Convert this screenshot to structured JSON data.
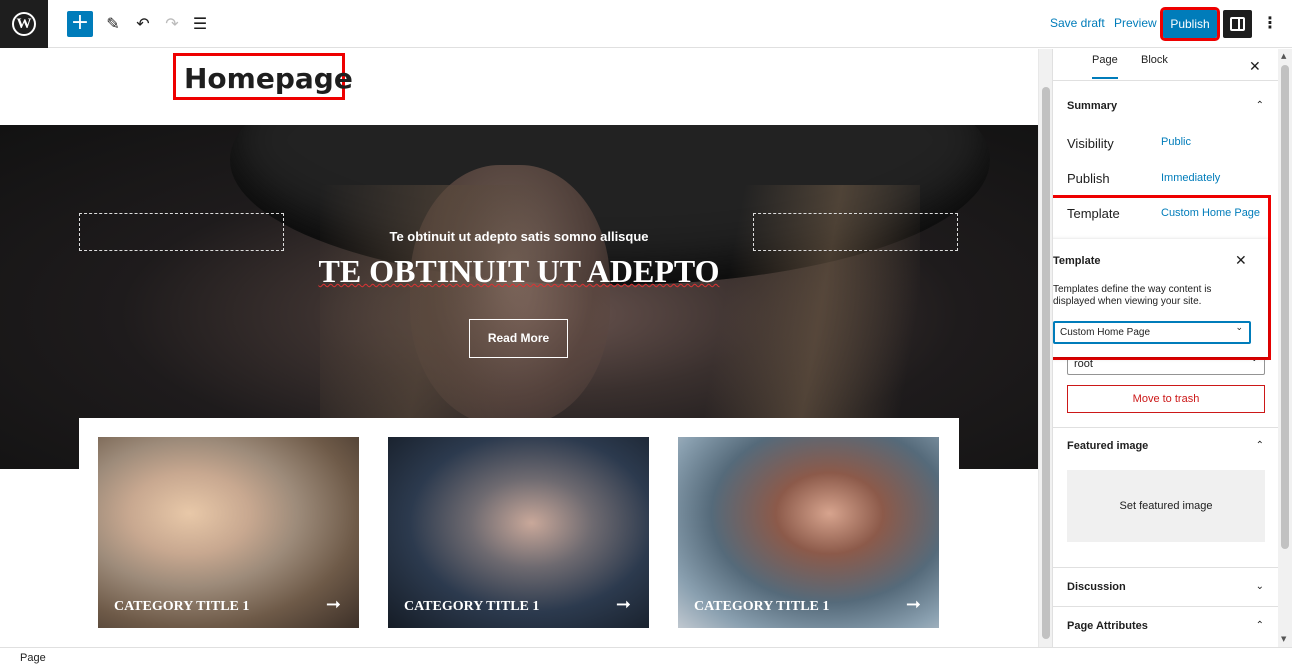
{
  "toolbar": {
    "add_icon": "plus-icon",
    "save_draft": "Save draft",
    "preview": "Preview",
    "publish": "Publish"
  },
  "page": {
    "title": "Homepage"
  },
  "hero": {
    "subtitle": "Te obtinuit ut adepto satis somno allisque",
    "title": "TE OBTINUIT UT ADEPTO",
    "button": "Read More"
  },
  "cards": [
    {
      "label": "CATEGORY TITLE 1"
    },
    {
      "label": "CATEGORY TITLE 1"
    },
    {
      "label": "CATEGORY TITLE 1"
    }
  ],
  "sidebar": {
    "tabs": [
      "Page",
      "Block"
    ],
    "summary": {
      "heading": "Summary",
      "rows": [
        {
          "label": "Visibility",
          "value": "Public"
        },
        {
          "label": "Publish",
          "value": "Immediately"
        },
        {
          "label": "Template",
          "value": "Custom Home Page"
        }
      ]
    },
    "template_popover": {
      "heading": "Template",
      "description": "Templates define the way content is displayed when viewing your site.",
      "selected": "Custom Home Page"
    },
    "parent_value": "root",
    "trash": "Move to trash",
    "featured_image": {
      "heading": "Featured image",
      "button": "Set featured image"
    },
    "discussion": "Discussion",
    "page_attributes": "Page Attributes"
  },
  "statusbar": {
    "breadcrumb": "Page"
  },
  "colors": {
    "accent": "#007cba",
    "highlight": "#ee0000",
    "danger": "#cc1818"
  }
}
